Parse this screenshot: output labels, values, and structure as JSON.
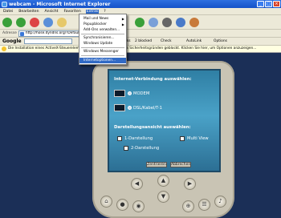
{
  "window": {
    "title": "webcam - Microsoft Internet Explorer"
  },
  "menubar": {
    "items": [
      "Datei",
      "Bearbeiten",
      "Ansicht",
      "Favoriten",
      "Extras",
      "?"
    ]
  },
  "address": {
    "label": "Adresse",
    "value": "http://hose.dyndns.org/?Defaul"
  },
  "googlebar": {
    "logo": "Google",
    "bookmark": "Bookmarks",
    "blocked": "2 blocked",
    "check": "Check",
    "autolink": "AutoLink",
    "options": "Options"
  },
  "infobar": {
    "text": "Die Installation eines ActiveX-Steuerelements ... Computer wurde aus Sicherheitsgründen geblockt. Klicken Sie hier, um Optionen anzuzeigen..."
  },
  "extras_menu": {
    "items": [
      {
        "label": "Mail und News",
        "submenu": true
      },
      {
        "label": "Popupblocker",
        "submenu": true
      },
      {
        "label": "Add-Ons verwalten...",
        "submenu": false
      },
      {
        "label": "Synchronisieren...",
        "submenu": false
      },
      {
        "label": "Windows Update",
        "submenu": false
      },
      {
        "label": "Windows Messenger",
        "submenu": false
      },
      {
        "label": "Internetoptionen...",
        "submenu": false
      }
    ]
  },
  "device": {
    "connection_heading": "Internet-Verbindung auswählen:",
    "connections": [
      "MODEM",
      "DSL/Kabel/T-1"
    ],
    "view_heading": "Darstellungsansicht auswählen:",
    "views": [
      "1-Darstellung",
      "2-Darstellung",
      "Multi View"
    ],
    "ok_button": "Zentrieren",
    "cancel_button": "Abbrechen"
  }
}
